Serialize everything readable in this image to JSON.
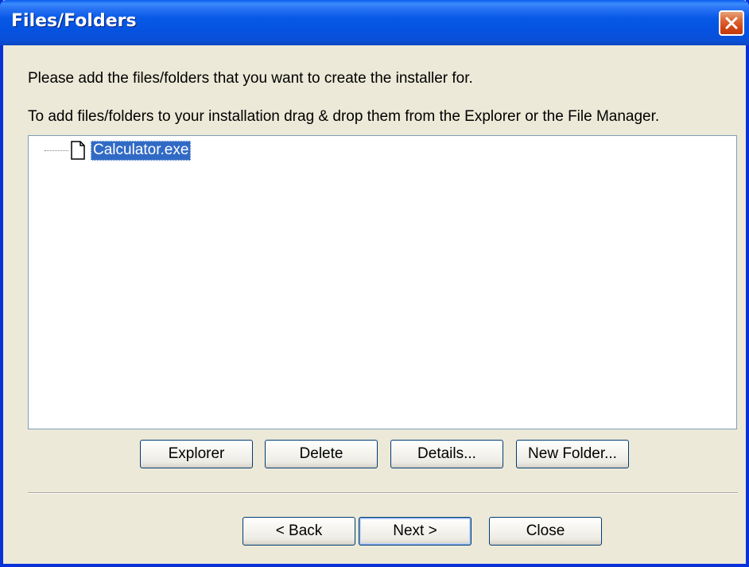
{
  "window": {
    "title": "Files/Folders",
    "close_icon": "close-x-icon"
  },
  "instructions": {
    "line1": "Please add the files/folders that you want to create the installer for.",
    "line2": "To add files/folders to your installation drag & drop them from the Explorer or the File Manager."
  },
  "tree": {
    "items": [
      {
        "label": "Calculator.exe",
        "icon": "file-icon",
        "selected": true
      }
    ]
  },
  "actions": {
    "explorer_label": "Explorer",
    "delete_label": "Delete",
    "details_label": "Details...",
    "new_folder_label": "New Folder..."
  },
  "nav": {
    "back_label": "< Back",
    "next_label": "Next >",
    "close_label": "Close"
  },
  "colors": {
    "titlebar": "#0759e7",
    "dialog_bg": "#ece9d8",
    "selection": "#316ac5",
    "close_button": "#d24614"
  }
}
